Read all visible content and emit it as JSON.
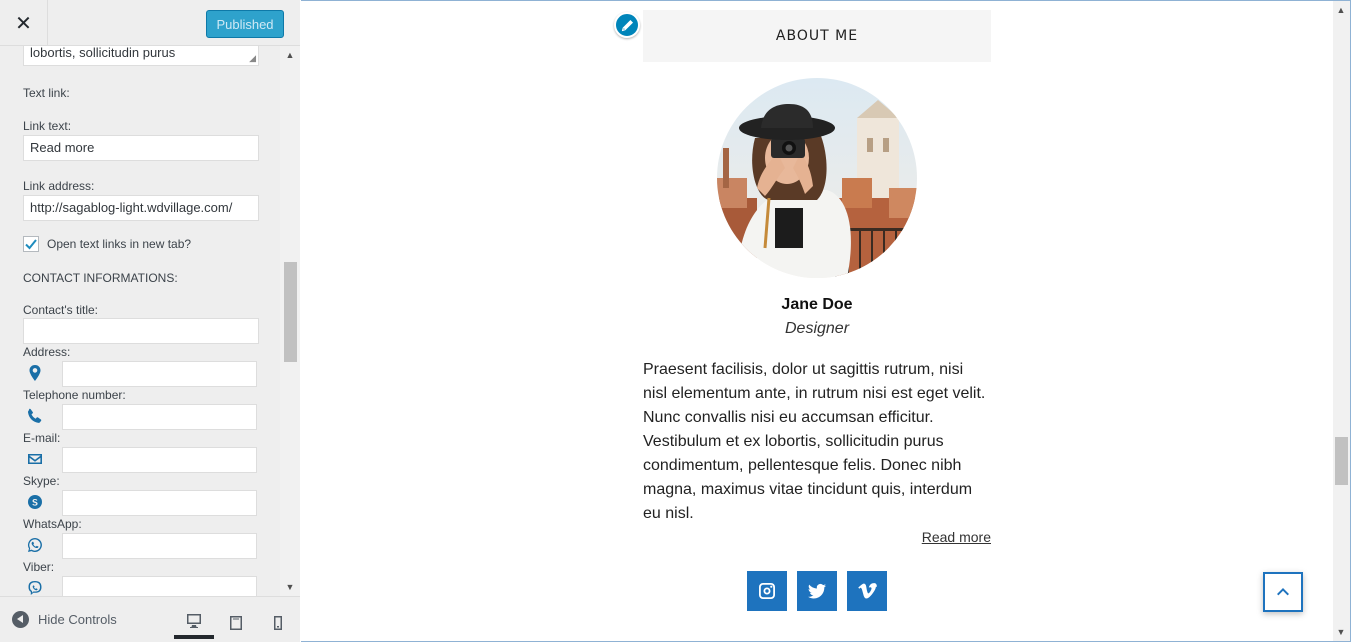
{
  "panel": {
    "close_glyph": "✕",
    "publish_label": "Published",
    "top_textarea_value": "lobortis, sollicitudin purus",
    "text_link_heading": "Text link:",
    "link_text_label": "Link text:",
    "link_text_value": "Read more",
    "link_address_label": "Link address:",
    "link_address_value": "http://sagablog-light.wdvillage.com/",
    "new_tab_label": "Open text links in new tab?",
    "new_tab_checked": true,
    "contact_heading": "CONTACT INFORMATIONS:",
    "contact_title_label": "Contact's title:",
    "address_label": "Address:",
    "telephone_label": "Telephone number:",
    "email_label": "E-mail:",
    "skype_label": "Skype:",
    "whatsapp_label": "WhatsApp:",
    "viber_label": "Viber:",
    "contact_icons": [
      "map-marker-icon",
      "phone-icon",
      "envelope-icon",
      "skype-icon",
      "whatsapp-icon",
      "viber-icon"
    ]
  },
  "footer": {
    "hide_controls_label": "Hide Controls",
    "devices": [
      "desktop-icon",
      "tablet-icon",
      "mobile-icon"
    ],
    "active_device": "desktop"
  },
  "preview": {
    "widget_title": "ABOUT ME",
    "name": "Jane Doe",
    "role": "Designer",
    "bio": "Praesent facilisis, dolor ut sagittis rutrum, nisi nisl elementum ante, in rutrum nisi est eget velit. Nunc convallis nisi eu accumsan efficitur. Vestibulum et ex lobortis, sollicitudin purus condimentum, pellentesque felis. Donec nibh magna, maximus vitae tincidunt quis, interdum eu nisl.",
    "read_more": "Read more",
    "socials": [
      "instagram-icon",
      "twitter-icon",
      "vimeo-icon"
    ],
    "accent_color": "#1e73be"
  }
}
